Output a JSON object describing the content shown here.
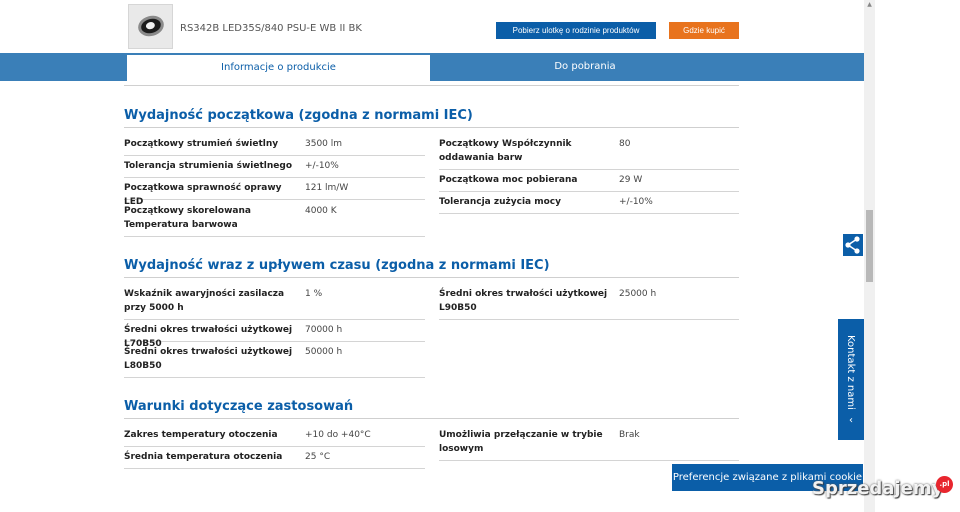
{
  "header": {
    "product_name": "RS342B LED35S/840 PSU-E WB II BK",
    "brochure_button": "Pobierz ulotkę o rodzinie produktów",
    "buy_button": "Gdzie kupić"
  },
  "tabs": [
    {
      "label": "Informacje o produkcie"
    },
    {
      "label": "Do pobrania"
    }
  ],
  "sections": [
    {
      "title": "Wydajność początkowa (zgodna z normami IEC)",
      "left": [
        {
          "label": "Początkowy strumień świetlny",
          "value": "3500 lm"
        },
        {
          "label": "Tolerancja strumienia świetlnego",
          "value": "+/-10%"
        },
        {
          "label": "Początkowa sprawność oprawy LED",
          "value": "121 lm/W"
        },
        {
          "label": "Początkowy skorelowana Temperatura barwowa",
          "value": "4000 K"
        }
      ],
      "right": [
        {
          "label": "Początkowy Współczynnik oddawania barw",
          "value": "80"
        },
        {
          "label": "Początkowa moc pobierana",
          "value": "29 W"
        },
        {
          "label": "Tolerancja zużycia mocy",
          "value": "+/-10%"
        }
      ]
    },
    {
      "title": "Wydajność wraz z upływem czasu (zgodna z normami IEC)",
      "left": [
        {
          "label": "Wskaźnik awaryjności zasilacza przy 5000 h",
          "value": "1 %"
        },
        {
          "label": "Średni okres trwałości użytkowej L70B50",
          "value": "70000 h"
        },
        {
          "label": "Średni okres trwałości użytkowej L80B50",
          "value": "50000 h"
        }
      ],
      "right": [
        {
          "label": "Średni okres trwałości użytkowej L90B50",
          "value": "25000 h"
        }
      ]
    },
    {
      "title": "Warunki dotyczące zastosowań",
      "left": [
        {
          "label": "Zakres temperatury otoczenia",
          "value": "+10 do +40°C"
        },
        {
          "label": "Średnia temperatura otoczenia",
          "value": "25 °C"
        }
      ],
      "right": [
        {
          "label": "Umożliwia przełączanie w trybie losowym",
          "value": "Brak"
        }
      ]
    }
  ],
  "floating": {
    "contact_label": "Kontakt z nami",
    "contact_chevron": "‹",
    "cookie_button": "Preferencje związane z plikami cookie",
    "share_icon": "share-icon"
  },
  "watermark": {
    "text": "Sprzedajemy",
    "badge": ".pl"
  },
  "colors": {
    "primary_blue": "#0b5ea8",
    "tab_bar_blue": "#3a7fb8",
    "orange": "#e8731d",
    "section_title": "#0b5ea8"
  }
}
